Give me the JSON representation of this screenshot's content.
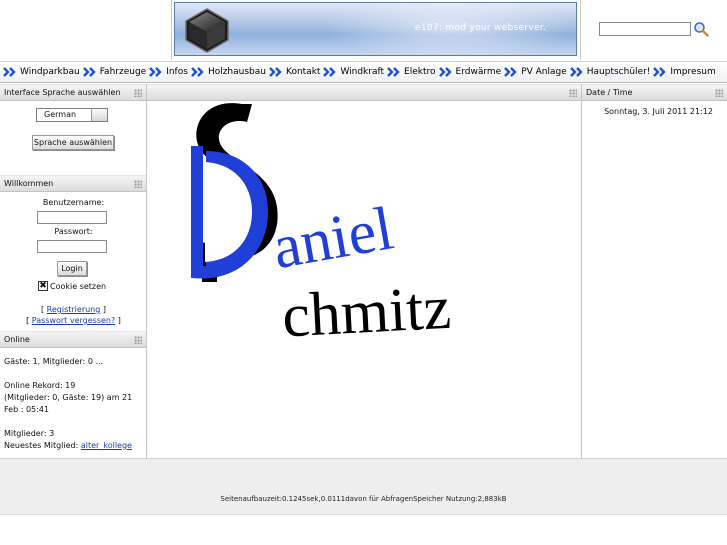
{
  "header": {
    "banner_tagline": "e107: mod your webserver.",
    "search_value": ""
  },
  "nav": {
    "items": [
      {
        "label": "Windparkbau"
      },
      {
        "label": "Fahrzeuge"
      },
      {
        "label": "Infos"
      },
      {
        "label": "Holzhausbau"
      },
      {
        "label": "Kontakt"
      },
      {
        "label": "Windkraft"
      },
      {
        "label": "Elektro"
      },
      {
        "label": "Erdwärme"
      },
      {
        "label": "PV Anlage"
      },
      {
        "label": "Hauptschüler!"
      },
      {
        "label": "Impresum"
      }
    ]
  },
  "language_box": {
    "title": "Interface Sprache auswählen",
    "selected": "German",
    "button": "Sprache auswählen"
  },
  "login_box": {
    "title": "Willkommen",
    "username_label": "Benutzername:",
    "password_label": "Passwort:",
    "login_button": "Login",
    "cookie_label": "Cookie setzen",
    "cookie_checked": true,
    "register_link": "Registrierung",
    "forgot_link": "Passwort vergessen?"
  },
  "online_box": {
    "title": "Online",
    "guests_line": "Gäste: 1, Mitglieder: 0 ...",
    "record_line1": "Online Rekord: 19",
    "record_line2": "(Mitglieder: 0, Gäste: 19) am 21",
    "record_line3": "Feb : 05:41",
    "members_line": "Mitglieder: 3",
    "newest_label": "Neuestes Mitglied:",
    "newest_member": "alter_kollege"
  },
  "main": {
    "logo_text_first": "aniel",
    "logo_text_last": "chmitz"
  },
  "date_box": {
    "title": "Date / Time",
    "value": "Sonntag, 3. Juli 2011 21:12"
  },
  "footer": {
    "text": "Seitenaufbauzeit:0.1245sek,0.0111davon für AbfragenSpeicher Nutzung:2,883kB"
  },
  "colors": {
    "logo_blue": "#1f3fd6",
    "logo_black": "#000000",
    "nav_arrow": "#1e52c8",
    "link": "#1a3fa0"
  }
}
